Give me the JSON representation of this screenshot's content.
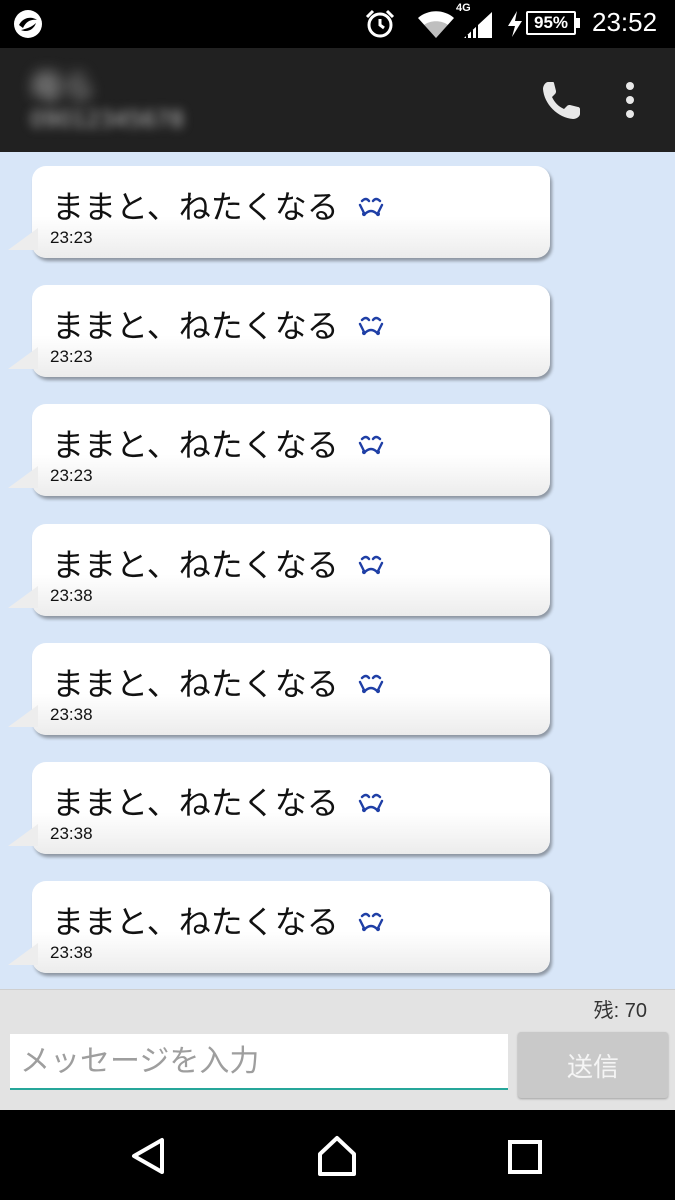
{
  "status_bar": {
    "app_icon": "app-logo-icon",
    "alarm_icon": "alarm-clock-icon",
    "wifi_icon": "wifi-icon",
    "network_type": "4G",
    "signal_icon": "cell-signal-icon",
    "charging_icon": "lightning-bolt-icon",
    "battery": "95%",
    "time": "23:52"
  },
  "app_bar": {
    "contact_name": "母ら",
    "contact_number": "09012345678",
    "call_icon": "phone-icon",
    "menu_icon": "more-vert-icon"
  },
  "messages": [
    {
      "text": "ままと、ねたくなる",
      "emoji": "crying-face-emoji",
      "time": "23:23"
    },
    {
      "text": "ままと、ねたくなる",
      "emoji": "crying-face-emoji",
      "time": "23:23"
    },
    {
      "text": "ままと、ねたくなる",
      "emoji": "crying-face-emoji",
      "time": "23:23"
    },
    {
      "text": "ままと、ねたくなる",
      "emoji": "crying-face-emoji",
      "time": "23:38"
    },
    {
      "text": "ままと、ねたくなる",
      "emoji": "crying-face-emoji",
      "time": "23:38"
    },
    {
      "text": "ままと、ねたくなる",
      "emoji": "crying-face-emoji",
      "time": "23:38"
    },
    {
      "text": "ままと、ねたくなる",
      "emoji": "crying-face-emoji",
      "time": "23:38"
    }
  ],
  "composer": {
    "remaining_label": "残: 70",
    "input_placeholder": "メッセージを入力",
    "input_value": "",
    "send_label": "送信"
  },
  "nav_bar": {
    "back_icon": "back-triangle-icon",
    "home_icon": "home-icon",
    "recent_icon": "recent-apps-icon"
  },
  "colors": {
    "chat_background": "#d8e6f8",
    "app_bar": "#212121",
    "input_accent": "#26a69a",
    "emoji_blue": "#1f3fa6"
  }
}
